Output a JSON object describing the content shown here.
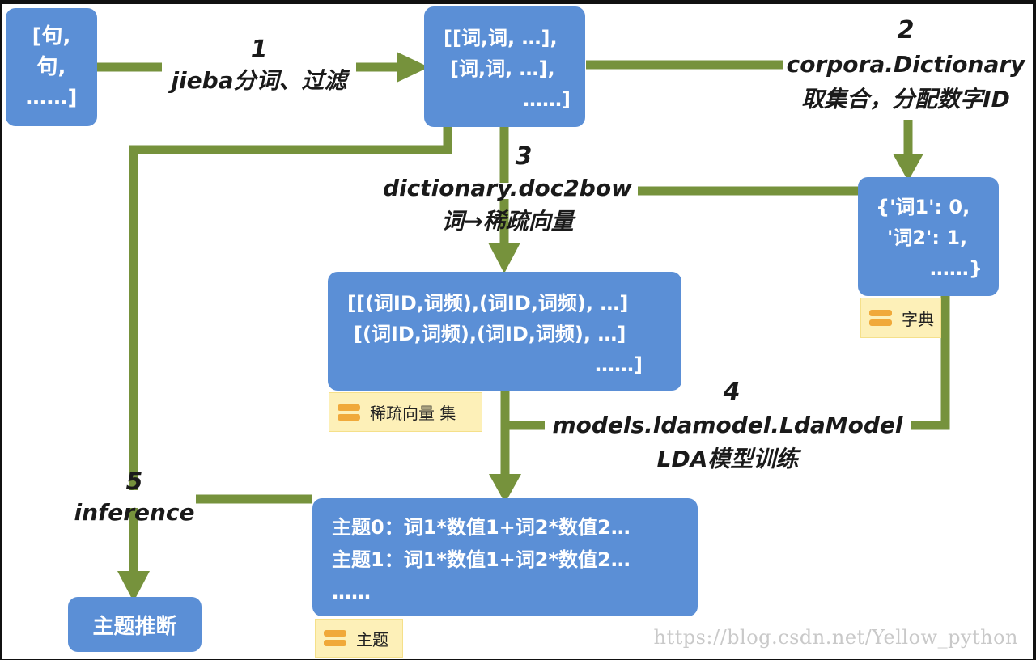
{
  "colors": {
    "box": "#5b8fd6",
    "wire": "#76923c",
    "tag_bg": "#fdf0b8",
    "tag_icon": "#f0a93a"
  },
  "nodes": {
    "sentences": {
      "lines": [
        "[句,",
        "句,",
        "……]"
      ]
    },
    "word_lists": {
      "lines": [
        "[[词,词, …],",
        "[词,词, …],",
        "……]"
      ]
    },
    "dictionary": {
      "lines": [
        "{'词1': 0,",
        "'词2': 1,",
        "……}"
      ]
    },
    "bow_corpus": {
      "lines": [
        "[[(词ID,词频),(词ID,词频), …]",
        "[(词ID,词频),(词ID,词频), …]",
        "……]"
      ]
    },
    "topics": {
      "lines": [
        "主题0：词1*数值1+词2*数值2…",
        "主题1：词1*数值1+词2*数值2…",
        "……"
      ]
    },
    "inference_result": {
      "label": "主题推断"
    }
  },
  "tags": {
    "dictionary": "字典",
    "bow_corpus": "稀疏向量 集",
    "topics": "主题"
  },
  "steps": [
    {
      "num": "1",
      "lines": [
        "jieba分词、过滤"
      ]
    },
    {
      "num": "2",
      "lines": [
        "corpora.Dictionary",
        "取集合，分配数字ID"
      ]
    },
    {
      "num": "3",
      "lines": [
        "dictionary.doc2bow",
        "词→稀疏向量"
      ]
    },
    {
      "num": "4",
      "lines": [
        "models.ldamodel.LdaModel",
        "LDA模型训练"
      ]
    },
    {
      "num": "5",
      "lines": [
        "inference"
      ]
    }
  ],
  "watermark": "https://blog.csdn.net/Yellow_python"
}
